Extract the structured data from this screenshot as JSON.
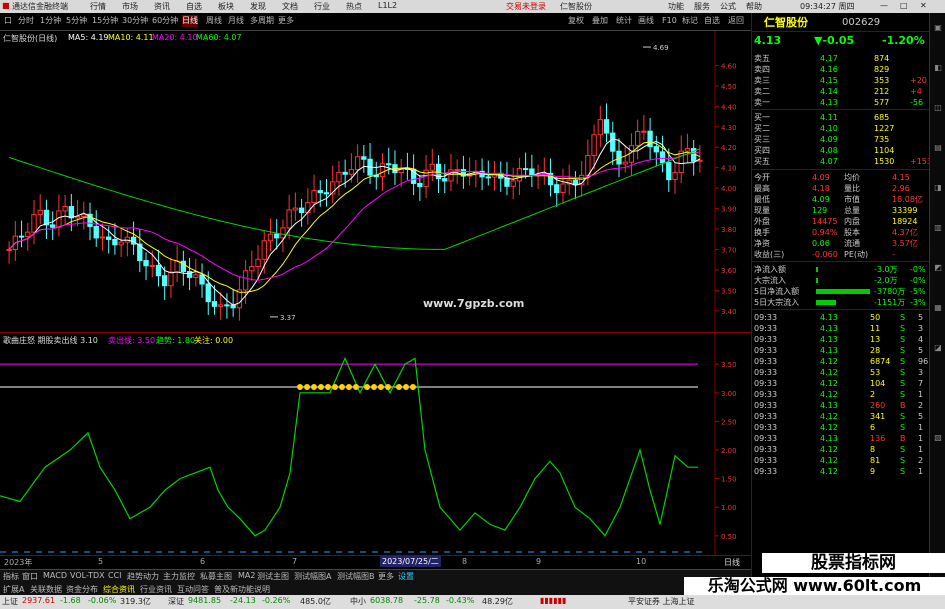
{
  "titlebar": {
    "app": "通达信金融终端",
    "menu": [
      "行情",
      "市场",
      "资讯",
      "自选",
      "板块",
      "发现",
      "文档",
      "行业",
      "热点",
      "L1L2"
    ],
    "center": "交易未登录",
    "stock": "仁智股份",
    "right": [
      "功能",
      "服务",
      "公式",
      "帮助"
    ],
    "time": "09:34:27 周四"
  },
  "toolbar": {
    "periods": [
      "分时",
      "1分钟",
      "5分钟",
      "15分钟",
      "30分钟",
      "60分钟",
      "日线",
      "周线",
      "月线",
      "多周期",
      "更多"
    ],
    "active": "日线",
    "right": [
      "复权",
      "叠加",
      "统计",
      "画线",
      "F10",
      "标记",
      "自选",
      "返回"
    ]
  },
  "main": {
    "title": "仁智股份(日线)",
    "ma": [
      {
        "label": "MA5: 4.19",
        "color": "#ffffff"
      },
      {
        "label": "MA10: 4.11",
        "color": "#ffff00"
      },
      {
        "label": "MA20: 4.10",
        "color": "#ff00ff"
      },
      {
        "label": "MA60: 4.07",
        "color": "#00ff00"
      }
    ],
    "price_axis": [
      "4.60",
      "4.50",
      "4.40",
      "4.30",
      "4.20",
      "4.10",
      "4.00",
      "3.90",
      "3.80",
      "3.70",
      "3.60",
      "3.50",
      "3.40"
    ],
    "high_label": "4.69",
    "low_label": "3.37",
    "watermark": "www.7gpzb.com"
  },
  "indicator": {
    "title": "歌曲庄怒  期股卖出线  3.10",
    "lines": [
      {
        "label": "卖出线: 3.50",
        "color": "#ff00ff"
      },
      {
        "label": "趋势: 1.80",
        "color": "#00ff00"
      },
      {
        "label": "关注: 0.00",
        "color": "#ffff00"
      }
    ],
    "axis": [
      "3.50",
      "3.00",
      "2.50",
      "2.00",
      "1.50",
      "1.00",
      "0.50"
    ]
  },
  "timeaxis": {
    "labels": [
      "2023年",
      "5",
      "6",
      "7",
      "2023/07/25/二",
      "8",
      "9",
      "10"
    ],
    "right": "日线"
  },
  "quote": {
    "name": "仁智股份",
    "code": "002629",
    "price": "4.13",
    "change": "▼-0.05",
    "pct": "-1.20%",
    "asks": [
      {
        "label": "卖五",
        "price": "4.17",
        "vol": "874"
      },
      {
        "label": "卖四",
        "price": "4.16",
        "vol": "829"
      },
      {
        "label": "卖三",
        "price": "4.15",
        "vol": "353",
        "d": "+20"
      },
      {
        "label": "卖二",
        "price": "4.14",
        "vol": "212",
        "d": "+4"
      },
      {
        "label": "卖一",
        "price": "4.13",
        "vol": "577",
        "d": "-56"
      }
    ],
    "bids": [
      {
        "label": "买一",
        "price": "4.11",
        "vol": "685"
      },
      {
        "label": "买二",
        "price": "4.10",
        "vol": "1227"
      },
      {
        "label": "买三",
        "price": "4.09",
        "vol": "735"
      },
      {
        "label": "买四",
        "price": "4.08",
        "vol": "1104"
      },
      {
        "label": "买五",
        "price": "4.07",
        "vol": "1530",
        "d": "+1530"
      }
    ],
    "stats": [
      [
        "今开",
        "4.09",
        "均价",
        "4.15"
      ],
      [
        "最高",
        "4.18",
        "量比",
        "2.96"
      ],
      [
        "最低",
        "4.09",
        "市值",
        "18.08亿"
      ],
      [
        "现量",
        "129",
        "总量",
        "33399"
      ],
      [
        "外盘",
        "14475",
        "内盘",
        "18924"
      ],
      [
        "换手",
        "0.94%",
        "股本",
        "4.37亿"
      ],
      [
        "净资",
        "0.06",
        "流通",
        "3.57亿"
      ],
      [
        "收益(三)",
        "-0.060",
        "PE(动)",
        "-"
      ]
    ],
    "flows": [
      [
        "净流入额",
        "-3.0万",
        "-0%"
      ],
      [
        "大宗流入",
        "-2.0万",
        "-0%"
      ],
      [
        "5日净流入额",
        "-3780万",
        "-5%"
      ],
      [
        "5日大宗流入",
        "-1151万",
        "-3%"
      ]
    ],
    "ticks": [
      [
        "09:33",
        "4.13",
        "50",
        "S",
        "5"
      ],
      [
        "09:33",
        "4.13",
        "11",
        "S",
        "3"
      ],
      [
        "09:33",
        "4.13",
        "13",
        "S",
        "4"
      ],
      [
        "09:33",
        "4.13",
        "28",
        "S",
        "5"
      ],
      [
        "09:33",
        "4.12",
        "6874",
        "S",
        "96"
      ],
      [
        "09:33",
        "4.12",
        "53",
        "S",
        "3"
      ],
      [
        "09:33",
        "4.12",
        "104",
        "S",
        "7"
      ],
      [
        "09:33",
        "4.12",
        "2",
        "S",
        "1"
      ],
      [
        "09:33",
        "4.13",
        "260",
        "B",
        "2"
      ],
      [
        "09:33",
        "4.12",
        "341",
        "S",
        "5"
      ],
      [
        "09:33",
        "4.12",
        "6",
        "S",
        "1"
      ],
      [
        "09:33",
        "4.13",
        "136",
        "B",
        "1"
      ],
      [
        "09:33",
        "4.12",
        "8",
        "S",
        "1"
      ],
      [
        "09:33",
        "4.12",
        "81",
        "S",
        "2"
      ],
      [
        "09:33",
        "4.12",
        "9",
        "S",
        "1"
      ]
    ]
  },
  "tabs": [
    "指标",
    "窗口",
    "MACD",
    "VOL-TDX",
    "CCI",
    "趋势动力",
    "主力监控",
    "私募主图",
    "MA2",
    "测试主图",
    "测试幅图A",
    "测试幅图B",
    "更多",
    "设置"
  ],
  "subtabs": [
    "扩展A",
    "关联数据",
    "资金分布",
    "综合资讯",
    "行业资讯",
    "互动问答",
    "普及新功能说明"
  ],
  "status": {
    "sh_label": "上证",
    "sh": "2937.61",
    "sh_chg": "-1.68",
    "sh_pct": "-0.06%",
    "sh_amt": "319.3亿",
    "sz_label": "深证",
    "sz": "9481.85",
    "sz_chg": "-24.13",
    "sz_pct": "-0.26%",
    "sz_amt": "485.0亿",
    "zx_label": "中小",
    "zx": "6038.78",
    "zx_chg": "-25.78",
    "zx_pct": "-0.43%",
    "zx_amt": "48.29亿",
    "right": "平安证券 上海上证"
  },
  "wm1": "股票指标网",
  "wm2": "乐淘公式网 www.60lt.com",
  "colors": {
    "up": "#ff3232",
    "down": "#54ffff",
    "green": "#00d200",
    "yellow": "#ffff00",
    "magenta": "#ff00ff"
  }
}
